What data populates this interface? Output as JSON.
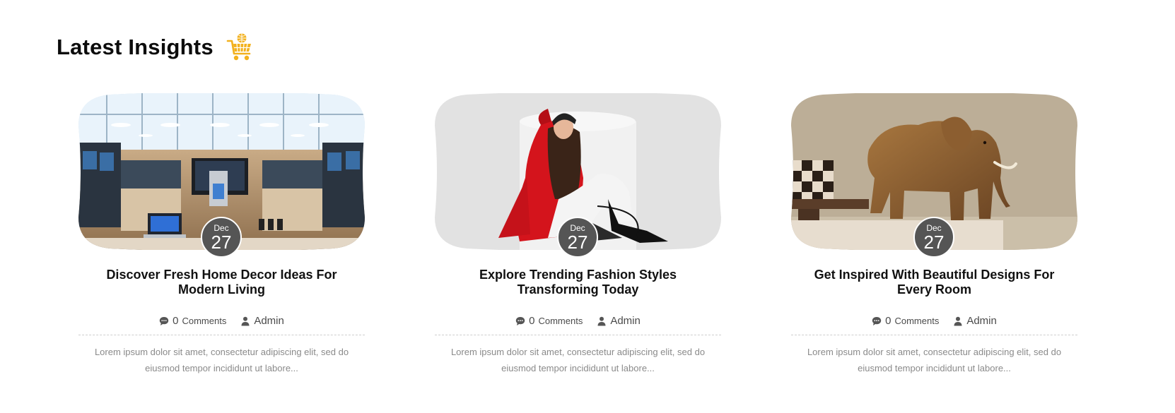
{
  "section": {
    "title": "Latest Insights",
    "icon": "shopping-cart-icon",
    "accent_color": "#f2b11e"
  },
  "posts": [
    {
      "image": "electronics-store-photo",
      "date": {
        "month": "Dec",
        "day": "27"
      },
      "title": "Discover Fresh Home Decor Ideas For Modern Living",
      "comments_count": "0",
      "comments_label": "Comments",
      "author": "Admin",
      "excerpt": "Lorem ipsum dolor sit amet, consectetur adipiscing elit, sed do eiusmod tempor incididunt ut labore..."
    },
    {
      "image": "fashion-model-photo",
      "date": {
        "month": "Dec",
        "day": "27"
      },
      "title": "Explore Trending Fashion Styles Transforming Today",
      "comments_count": "0",
      "comments_label": "Comments",
      "author": "Admin",
      "excerpt": "Lorem ipsum dolor sit amet, consectetur adipiscing elit, sed do eiusmod tempor incididunt ut labore..."
    },
    {
      "image": "wooden-elephant-photo",
      "date": {
        "month": "Dec",
        "day": "27"
      },
      "title": "Get Inspired With Beautiful Designs For Every Room",
      "comments_count": "0",
      "comments_label": "Comments",
      "author": "Admin",
      "excerpt": "Lorem ipsum dolor sit amet, consectetur adipiscing elit, sed do eiusmod tempor incididunt ut labore..."
    }
  ],
  "colors": {
    "date_badge": "#555555",
    "meta_text": "#4a4a4a",
    "excerpt_text": "#8a8a8a"
  }
}
